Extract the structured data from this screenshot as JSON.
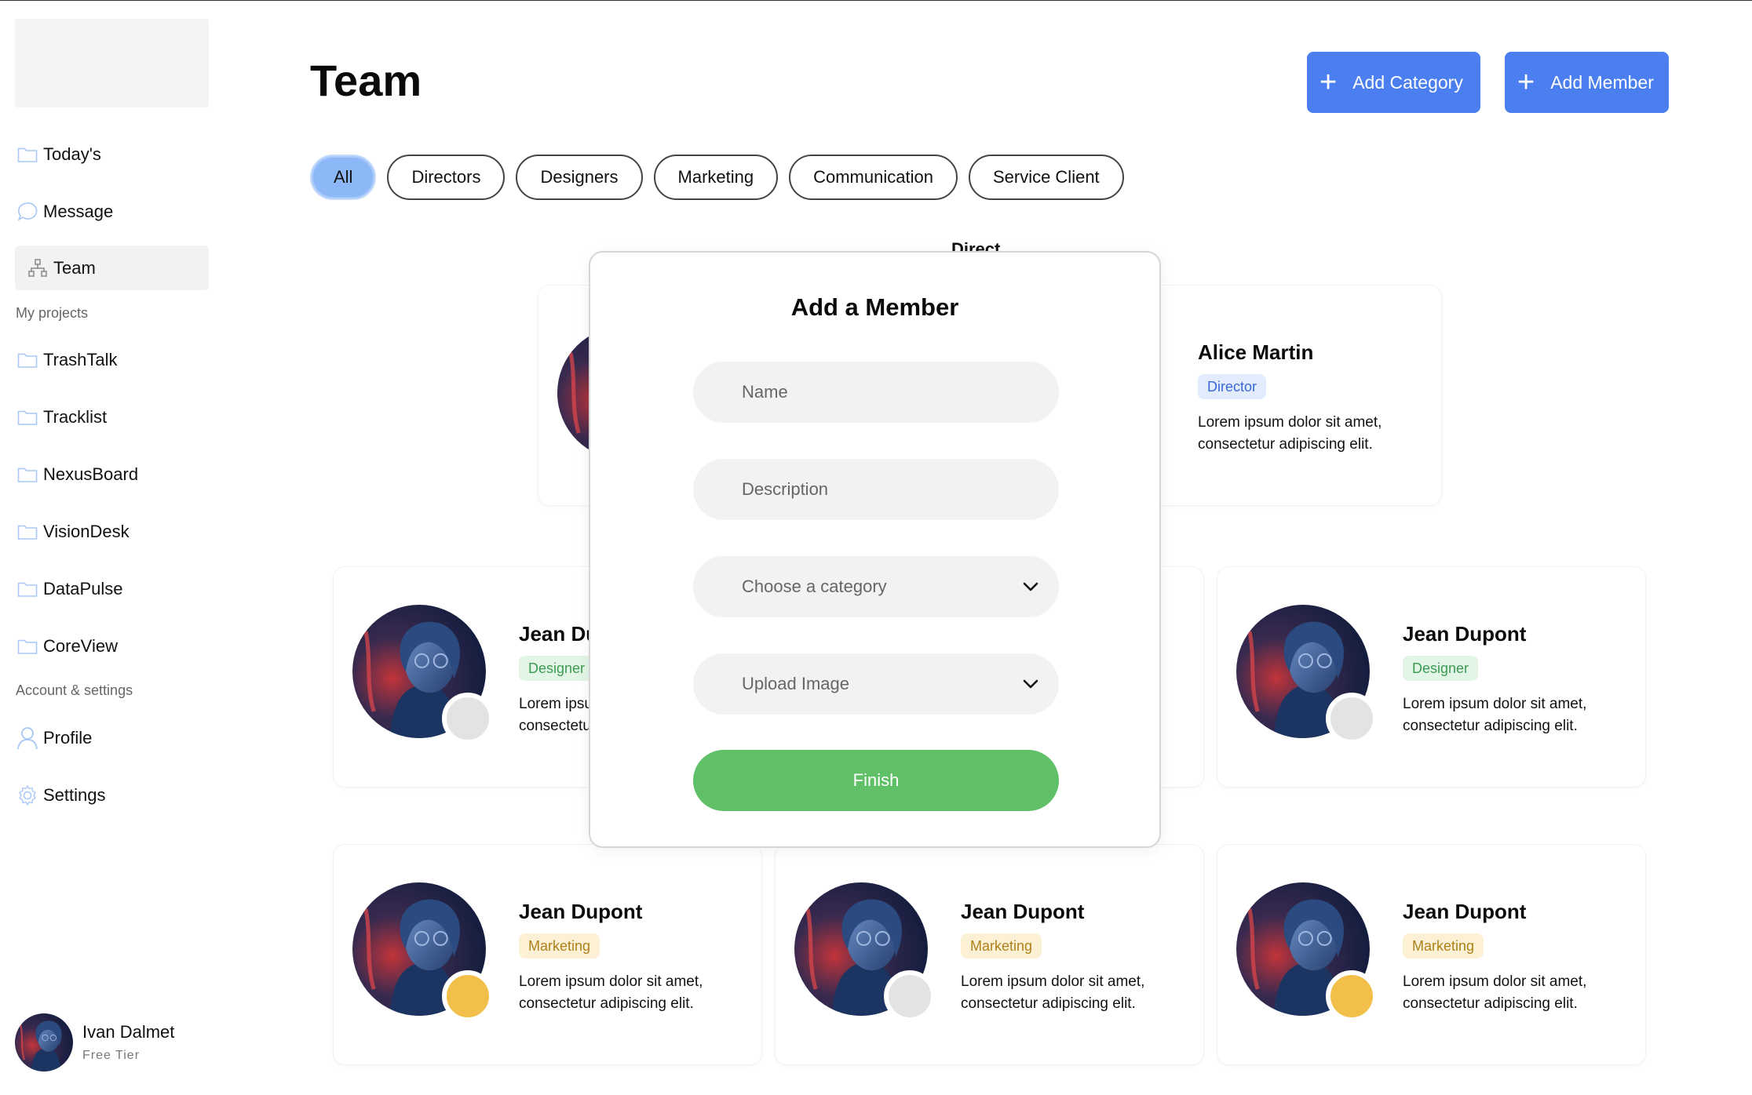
{
  "sidebar": {
    "nav": [
      {
        "label": "Today's",
        "icon": "folder-icon"
      },
      {
        "label": "Message",
        "icon": "chat-bubble-icon"
      },
      {
        "label": "Team",
        "icon": "team-hierarchy-icon"
      }
    ],
    "projects_label": "My projects",
    "projects": [
      "TrashTalk",
      "Tracklist",
      "NexusBoard",
      "VisionDesk",
      "DataPulse",
      "CoreView"
    ],
    "account_label": "Account & settings",
    "account": [
      {
        "label": "Profile",
        "icon": "user-icon"
      },
      {
        "label": "Settings",
        "icon": "gear-icon"
      }
    ],
    "user": {
      "name": "Ivan Dalmet",
      "tier": "Free Tier"
    }
  },
  "header": {
    "title": "Team",
    "add_category": "Add Category",
    "add_member": "Add Member"
  },
  "filters": [
    "All",
    "Directors",
    "Designers",
    "Marketing",
    "Communication",
    "Service Client"
  ],
  "section_heading": "Direct",
  "cards": [
    {
      "name": "Alice Martin",
      "badge": "Director",
      "desc1": "Lorem ipsum dolor sit amet,",
      "desc2": "consectetur adipiscing elit."
    },
    {
      "name": "Jean Dupont",
      "badge": "Designer",
      "desc1": "Lorem ipsum dolor sit amet,",
      "desc2": "consectetur adipiscing elit."
    },
    {
      "name": "Jean Dupont",
      "badge": "Designer",
      "desc1": "Lorem ipsum dolor sit amet,",
      "desc2": "consectetur adipiscing elit."
    },
    {
      "name": "Jean Dupont",
      "badge": "Marketing",
      "desc1": "Lorem ipsum dolor sit amet,",
      "desc2": "consectetur adipiscing elit."
    },
    {
      "name": "Jean Dupont",
      "badge": "Marketing",
      "desc1": "Lorem ipsum dolor sit amet,",
      "desc2": "consectetur adipiscing elit."
    },
    {
      "name": "Jean Dupont",
      "badge": "Marketing",
      "desc1": "Lorem ipsum dolor sit amet,",
      "desc2": "consectetur adipiscing elit."
    }
  ],
  "modal": {
    "title": "Add a Member",
    "name_placeholder": "Name",
    "description_placeholder": "Description",
    "category_placeholder": "Choose a category",
    "upload_label": "Upload Image",
    "finish": "Finish"
  },
  "colors": {
    "accent": "#4b7ff0",
    "finish": "#5fc068",
    "chip_active": "#8db8f8",
    "status_yellow": "#f2c04a",
    "status_gray": "#e3e3e3"
  }
}
